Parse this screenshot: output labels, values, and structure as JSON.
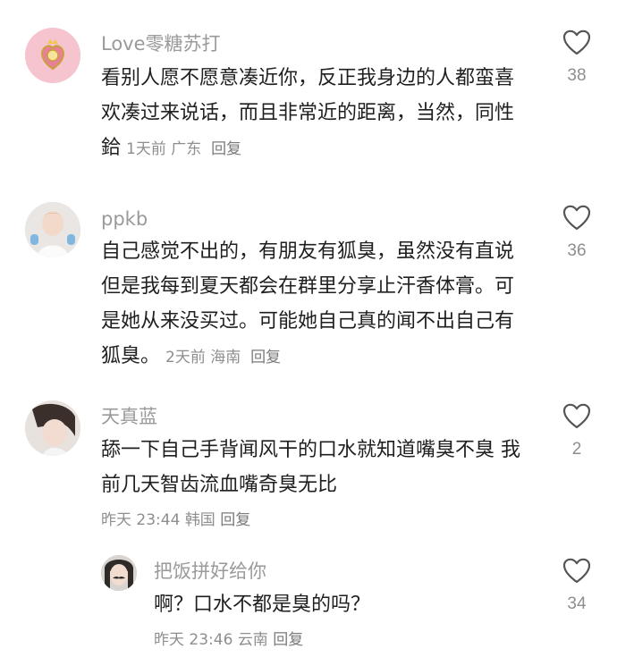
{
  "comments": [
    {
      "username": "Love零糖苏打",
      "text": "看别人愿不愿意凑近你，反正我身边的人都蛮喜欢凑过来说话，而且非常近的距离，当然，同性鉿",
      "time": "1天前",
      "location": "广东",
      "reply_label": "回复",
      "likes": "38",
      "avatar_icon": "pink-heart-badge-icon"
    },
    {
      "username": "ppkb",
      "text": "自己感觉不出的，有朋友有狐臭，虽然没有直说但是我每到夏天都会在群里分享止汗香体膏。可是她从来没买过。可能她自己真的闻不出自己有狐臭。",
      "time": "2天前",
      "location": "海南",
      "reply_label": "回复",
      "likes": "36",
      "avatar_icon": "girl-photo-avatar"
    },
    {
      "username": "天真蓝",
      "text": "舔一下自己手背闻风干的口水就知道嘴臭不臭 我前几天智齿流血嘴奇臭无比",
      "time": "昨天 23:44",
      "location": "韩国",
      "reply_label": "回复",
      "likes": "2",
      "avatar_icon": "girl-photo-avatar"
    }
  ],
  "replies": [
    {
      "username": "把饭拼好给你",
      "text": "啊？口水不都是臭的吗？",
      "time": "昨天 23:46",
      "location": "云南",
      "reply_label": "回复",
      "likes": "34",
      "avatar_icon": "mustache-girl-avatar"
    }
  ],
  "colors": {
    "username": "#9a9a9a",
    "text": "#1f1f1f",
    "meta": "#8e8e8e",
    "heart": "#555555"
  }
}
